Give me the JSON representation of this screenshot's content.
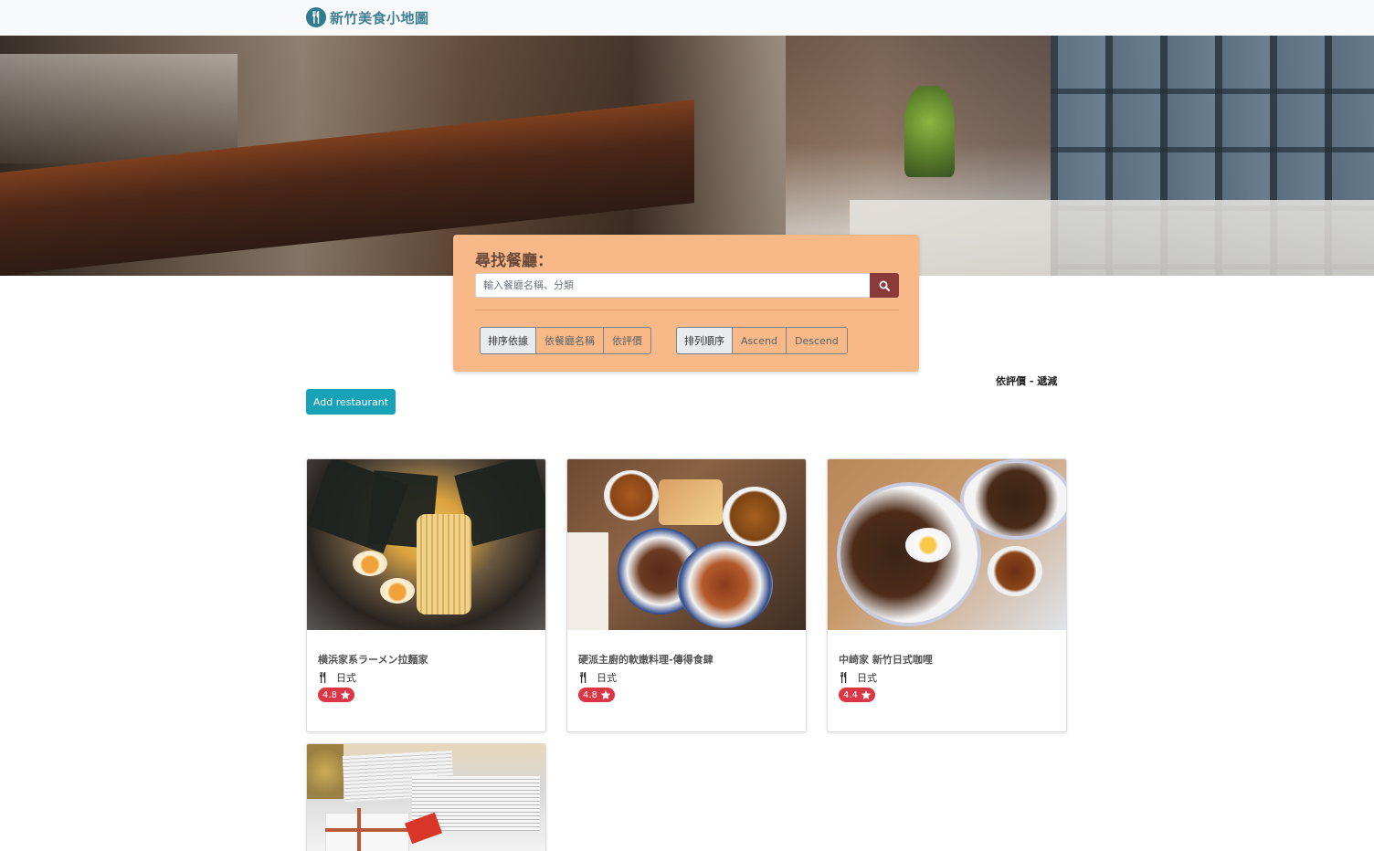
{
  "navbar": {
    "brand": "新竹美食小地圖",
    "brand_icon": "utensils-icon"
  },
  "search": {
    "title": "尋找餐廳：",
    "placeholder": "輸入餐廳名稱、分類",
    "button_icon": "search-icon"
  },
  "sort": {
    "by_label": "排序依據",
    "by_options": [
      "依餐廳名稱",
      "依評價"
    ],
    "order_label": "排列順序",
    "order_options": [
      "Ascend",
      "Descend"
    ],
    "current_by": "依評價",
    "separator": " - ",
    "current_order": "遞減"
  },
  "add_restaurant_label": "Add restaurant",
  "restaurants": [
    {
      "name": "横浜家系ラーメン拉麵家",
      "category": "日式",
      "rating": "4.8"
    },
    {
      "name": "硬派主廚的軟嫩料理-傳得食肆",
      "category": "日式",
      "rating": "4.8"
    },
    {
      "name": "中崎家 新竹日式咖哩",
      "category": "日式",
      "rating": "4.4"
    },
    {
      "name": "",
      "category": "",
      "rating": ""
    }
  ],
  "colors": {
    "navbar_bg": "#f8f9fa",
    "brand": "#3f7f93",
    "search_panel_bg": "#f8b887",
    "search_button": "#8b3a3a",
    "add_button": "#17a2b8",
    "rating_badge": "#dc3545"
  }
}
